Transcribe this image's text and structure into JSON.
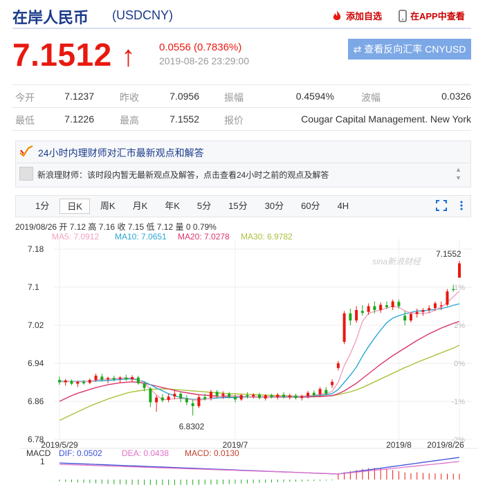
{
  "header": {
    "title": "在岸人民币",
    "code": "(USDCNY)",
    "add_label": "添加自选",
    "app_label": "在APP中查看"
  },
  "quote": {
    "price": "7.1512",
    "arrow": "↑",
    "change": "0.0556 (0.7836%)",
    "time": "2019-08-26 23:29:00",
    "reverse_label": "⇄ 查看反向汇率 CNYUSD"
  },
  "stats": {
    "open_label": "今开",
    "open": "7.1237",
    "prev_label": "昨收",
    "prev": "7.0956",
    "amp_label": "振幅",
    "amp": "0.4594%",
    "vol_label": "波幅",
    "vol": "0.0326",
    "low_label": "最低",
    "low": "7.1226",
    "high_label": "最高",
    "high": "7.1552",
    "quote_label": "报价",
    "quote_source": "Cougar Capital Management. New York"
  },
  "opinion": {
    "title": "24小时内理财师对汇市最新观点和解答",
    "text": "新浪理财师：该时段内暂无最新观点及解答，点击查看24小时之前的观点及解答"
  },
  "tabs": [
    "1分",
    "日K",
    "周K",
    "月K",
    "年K",
    "5分",
    "15分",
    "30分",
    "60分",
    "4H"
  ],
  "active_tab": 1,
  "colors": {
    "up": "#e8190f",
    "down": "#1aa81a",
    "ma5": "#f2a0c0",
    "ma10": "#2aa7d6",
    "ma20": "#d9346c",
    "ma30": "#a9c23c",
    "dif": "#3a4fd6",
    "dea": "#e070c8"
  },
  "chart_info": {
    "line1": "2019/08/26  开 7.12  高 7.16  收 7.15  低 7.12  量 0  0.79%",
    "ma5": "MA5: 7.0912",
    "ma10": "MA10: 7.0651",
    "ma20": "MA20: 7.0278",
    "ma30": "MA30: 6.9782",
    "high_mark": "7.1552",
    "low_mark": "6.8302",
    "watermark": "sina新浪财经",
    "macd_label": "MACD",
    "dif": "DIF: 0.0502",
    "dea": "DEA: 0.0438",
    "macd": "MACD: 0.0130",
    "macd_tick": "1"
  },
  "chart_data": {
    "type": "candlestick",
    "ylim": [
      6.78,
      7.18
    ],
    "y_ticks": [
      "7.18",
      "7.1",
      "7.02",
      "6.94",
      "6.86",
      "6.78"
    ],
    "pct_ticks": [
      "",
      "1%",
      "2%",
      "0%",
      "-1%",
      "-2%"
    ],
    "x_ticks": [
      "2019/5/29",
      "2019/7",
      "2019/8",
      "2019/8/26"
    ],
    "candles": [
      [
        6.905,
        6.912,
        6.895,
        6.9
      ],
      [
        6.9,
        6.907,
        6.893,
        6.904
      ],
      [
        6.903,
        6.906,
        6.894,
        6.897
      ],
      [
        6.897,
        6.903,
        6.89,
        6.901
      ],
      [
        6.901,
        6.905,
        6.895,
        6.898
      ],
      [
        6.899,
        6.908,
        6.896,
        6.905
      ],
      [
        6.905,
        6.918,
        6.901,
        6.914
      ],
      [
        6.912,
        6.918,
        6.902,
        6.905
      ],
      [
        6.906,
        6.912,
        6.898,
        6.909
      ],
      [
        6.909,
        6.914,
        6.902,
        6.906
      ],
      [
        6.907,
        6.913,
        6.899,
        6.91
      ],
      [
        6.91,
        6.916,
        6.903,
        6.906
      ],
      [
        6.906,
        6.915,
        6.9,
        6.911
      ],
      [
        6.91,
        6.914,
        6.895,
        6.898
      ],
      [
        6.898,
        6.902,
        6.881,
        6.888
      ],
      [
        6.887,
        6.89,
        6.848,
        6.858
      ],
      [
        6.858,
        6.873,
        6.838,
        6.868
      ],
      [
        6.868,
        6.875,
        6.858,
        6.862
      ],
      [
        6.863,
        6.876,
        6.858,
        6.87
      ],
      [
        6.87,
        6.883,
        6.864,
        6.876
      ],
      [
        6.876,
        6.88,
        6.858,
        6.866
      ],
      [
        6.866,
        6.873,
        6.852,
        6.858
      ],
      [
        6.856,
        6.864,
        6.83,
        6.85
      ],
      [
        6.85,
        6.873,
        6.846,
        6.869
      ],
      [
        6.869,
        6.876,
        6.862,
        6.865
      ],
      [
        6.867,
        6.884,
        6.862,
        6.88
      ],
      [
        6.88,
        6.884,
        6.867,
        6.872
      ],
      [
        6.872,
        6.881,
        6.865,
        6.876
      ],
      [
        6.876,
        6.88,
        6.866,
        6.87
      ],
      [
        6.87,
        6.875,
        6.858,
        6.864
      ],
      [
        6.864,
        6.876,
        6.861,
        6.873
      ],
      [
        6.873,
        6.879,
        6.866,
        6.87
      ],
      [
        6.87,
        6.877,
        6.866,
        6.874
      ],
      [
        6.874,
        6.878,
        6.864,
        6.867
      ],
      [
        6.866,
        6.875,
        6.862,
        6.873
      ],
      [
        6.873,
        6.876,
        6.866,
        6.869
      ],
      [
        6.869,
        6.877,
        6.864,
        6.874
      ],
      [
        6.874,
        6.879,
        6.866,
        6.869
      ],
      [
        6.869,
        6.876,
        6.864,
        6.872
      ],
      [
        6.872,
        6.876,
        6.864,
        6.867
      ],
      [
        6.867,
        6.874,
        6.862,
        6.871
      ],
      [
        6.871,
        6.882,
        6.866,
        6.878
      ],
      [
        6.878,
        6.883,
        6.868,
        6.873
      ],
      [
        6.875,
        6.89,
        6.87,
        6.886
      ],
      [
        6.884,
        6.89,
        6.872,
        6.876
      ],
      [
        6.894,
        6.906,
        6.888,
        6.901
      ],
      [
        6.93,
        6.945,
        6.925,
        6.94
      ],
      [
        6.985,
        7.05,
        6.98,
        7.045
      ],
      [
        7.045,
        7.055,
        7.02,
        7.03
      ],
      [
        7.03,
        7.06,
        7.025,
        7.052
      ],
      [
        7.05,
        7.062,
        7.04,
        7.046
      ],
      [
        7.048,
        7.066,
        7.042,
        7.06
      ],
      [
        7.06,
        7.07,
        7.045,
        7.052
      ],
      [
        7.052,
        7.068,
        7.046,
        7.063
      ],
      [
        7.062,
        7.07,
        7.054,
        7.058
      ],
      [
        7.058,
        7.074,
        7.052,
        7.07
      ],
      [
        7.069,
        7.074,
        7.055,
        7.06
      ],
      [
        7.04,
        7.05,
        7.02,
        7.03
      ],
      [
        7.03,
        7.048,
        7.026,
        7.044
      ],
      [
        7.044,
        7.055,
        7.036,
        7.048
      ],
      [
        7.048,
        7.056,
        7.04,
        7.052
      ],
      [
        7.052,
        7.062,
        7.046,
        7.056
      ],
      [
        7.056,
        7.07,
        7.05,
        7.066
      ],
      [
        7.06,
        7.07,
        7.052,
        7.062
      ],
      [
        7.063,
        7.096,
        7.06,
        7.091
      ],
      [
        7.096,
        7.105,
        7.09,
        7.094
      ],
      [
        7.12,
        7.155,
        7.12,
        7.15
      ]
    ],
    "ma5": [
      6.901,
      6.901,
      6.902,
      6.901,
      6.901,
      6.902,
      6.905,
      6.906,
      6.907,
      6.908,
      6.909,
      6.909,
      6.909,
      6.906,
      6.898,
      6.886,
      6.873,
      6.864,
      6.864,
      6.866,
      6.866,
      6.865,
      6.863,
      6.863,
      6.864,
      6.867,
      6.869,
      6.872,
      6.872,
      6.872,
      6.871,
      6.87,
      6.87,
      6.87,
      6.87,
      6.87,
      6.871,
      6.871,
      6.871,
      6.871,
      6.871,
      6.872,
      6.873,
      6.875,
      6.876,
      6.881,
      6.9,
      6.935,
      6.96,
      6.99,
      7.028,
      7.045,
      7.049,
      7.052,
      7.056,
      7.06,
      7.058,
      7.05,
      7.046,
      7.044,
      7.045,
      7.046,
      7.052,
      7.058,
      7.068,
      7.08,
      7.092
    ],
    "ma10": [
      6.902,
      6.902,
      6.902,
      6.902,
      6.902,
      6.902,
      6.903,
      6.903,
      6.904,
      6.905,
      6.906,
      6.907,
      6.907,
      6.905,
      6.901,
      6.895,
      6.888,
      6.882,
      6.876,
      6.872,
      6.868,
      6.866,
      6.864,
      6.864,
      6.865,
      6.866,
      6.867,
      6.868,
      6.868,
      6.868,
      6.869,
      6.869,
      6.87,
      6.87,
      6.87,
      6.87,
      6.87,
      6.87,
      6.87,
      6.87,
      6.87,
      6.871,
      6.872,
      6.873,
      6.874,
      6.876,
      6.885,
      6.9,
      6.915,
      6.932,
      6.955,
      6.975,
      6.993,
      7.01,
      7.025,
      7.035,
      7.04,
      7.044,
      7.047,
      7.05,
      7.05,
      7.052,
      7.053,
      7.055,
      7.058,
      7.062,
      7.065
    ],
    "ma20": [
      6.86,
      6.866,
      6.872,
      6.877,
      6.881,
      6.885,
      6.889,
      6.892,
      6.895,
      6.897,
      6.899,
      6.9,
      6.901,
      6.9,
      6.898,
      6.895,
      6.892,
      6.889,
      6.886,
      6.883,
      6.88,
      6.878,
      6.876,
      6.874,
      6.873,
      6.872,
      6.871,
      6.87,
      6.869,
      6.869,
      6.869,
      6.869,
      6.869,
      6.869,
      6.869,
      6.869,
      6.869,
      6.869,
      6.869,
      6.869,
      6.869,
      6.869,
      6.87,
      6.87,
      6.871,
      6.872,
      6.876,
      6.882,
      6.89,
      6.898,
      6.908,
      6.918,
      6.928,
      6.938,
      6.947,
      6.956,
      6.964,
      6.972,
      6.98,
      6.988,
      6.995,
      7.002,
      7.008,
      7.014,
      7.019,
      7.024,
      7.028
    ],
    "ma30": [
      6.82,
      6.826,
      6.832,
      6.838,
      6.844,
      6.85,
      6.855,
      6.86,
      6.865,
      6.869,
      6.873,
      6.877,
      6.88,
      6.882,
      6.884,
      6.885,
      6.886,
      6.886,
      6.886,
      6.885,
      6.884,
      6.883,
      6.882,
      6.881,
      6.88,
      6.879,
      6.878,
      6.877,
      6.876,
      6.876,
      6.875,
      6.875,
      6.874,
      6.874,
      6.873,
      6.873,
      6.872,
      6.872,
      6.872,
      6.871,
      6.871,
      6.871,
      6.871,
      6.871,
      6.871,
      6.872,
      6.874,
      6.877,
      6.88,
      6.884,
      6.889,
      6.895,
      6.901,
      6.907,
      6.913,
      6.919,
      6.925,
      6.931,
      6.936,
      6.942,
      6.947,
      6.952,
      6.957,
      6.962,
      6.967,
      6.972,
      6.978
    ]
  }
}
